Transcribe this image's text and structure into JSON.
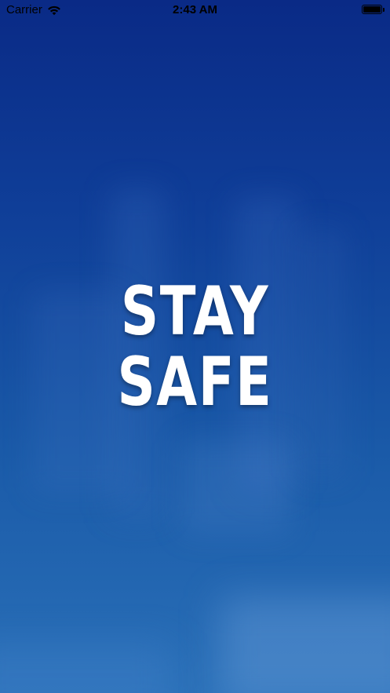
{
  "status_bar": {
    "carrier": "Carrier",
    "time": "2:43 AM",
    "wifi_icon": "wifi-icon",
    "battery_icon": "battery-icon"
  },
  "splash": {
    "line1": "STAY",
    "line2": "SAFE"
  },
  "colors": {
    "background_top": "#0a2a86",
    "background_bottom": "#2a70b8",
    "headline": "#ffffff"
  }
}
